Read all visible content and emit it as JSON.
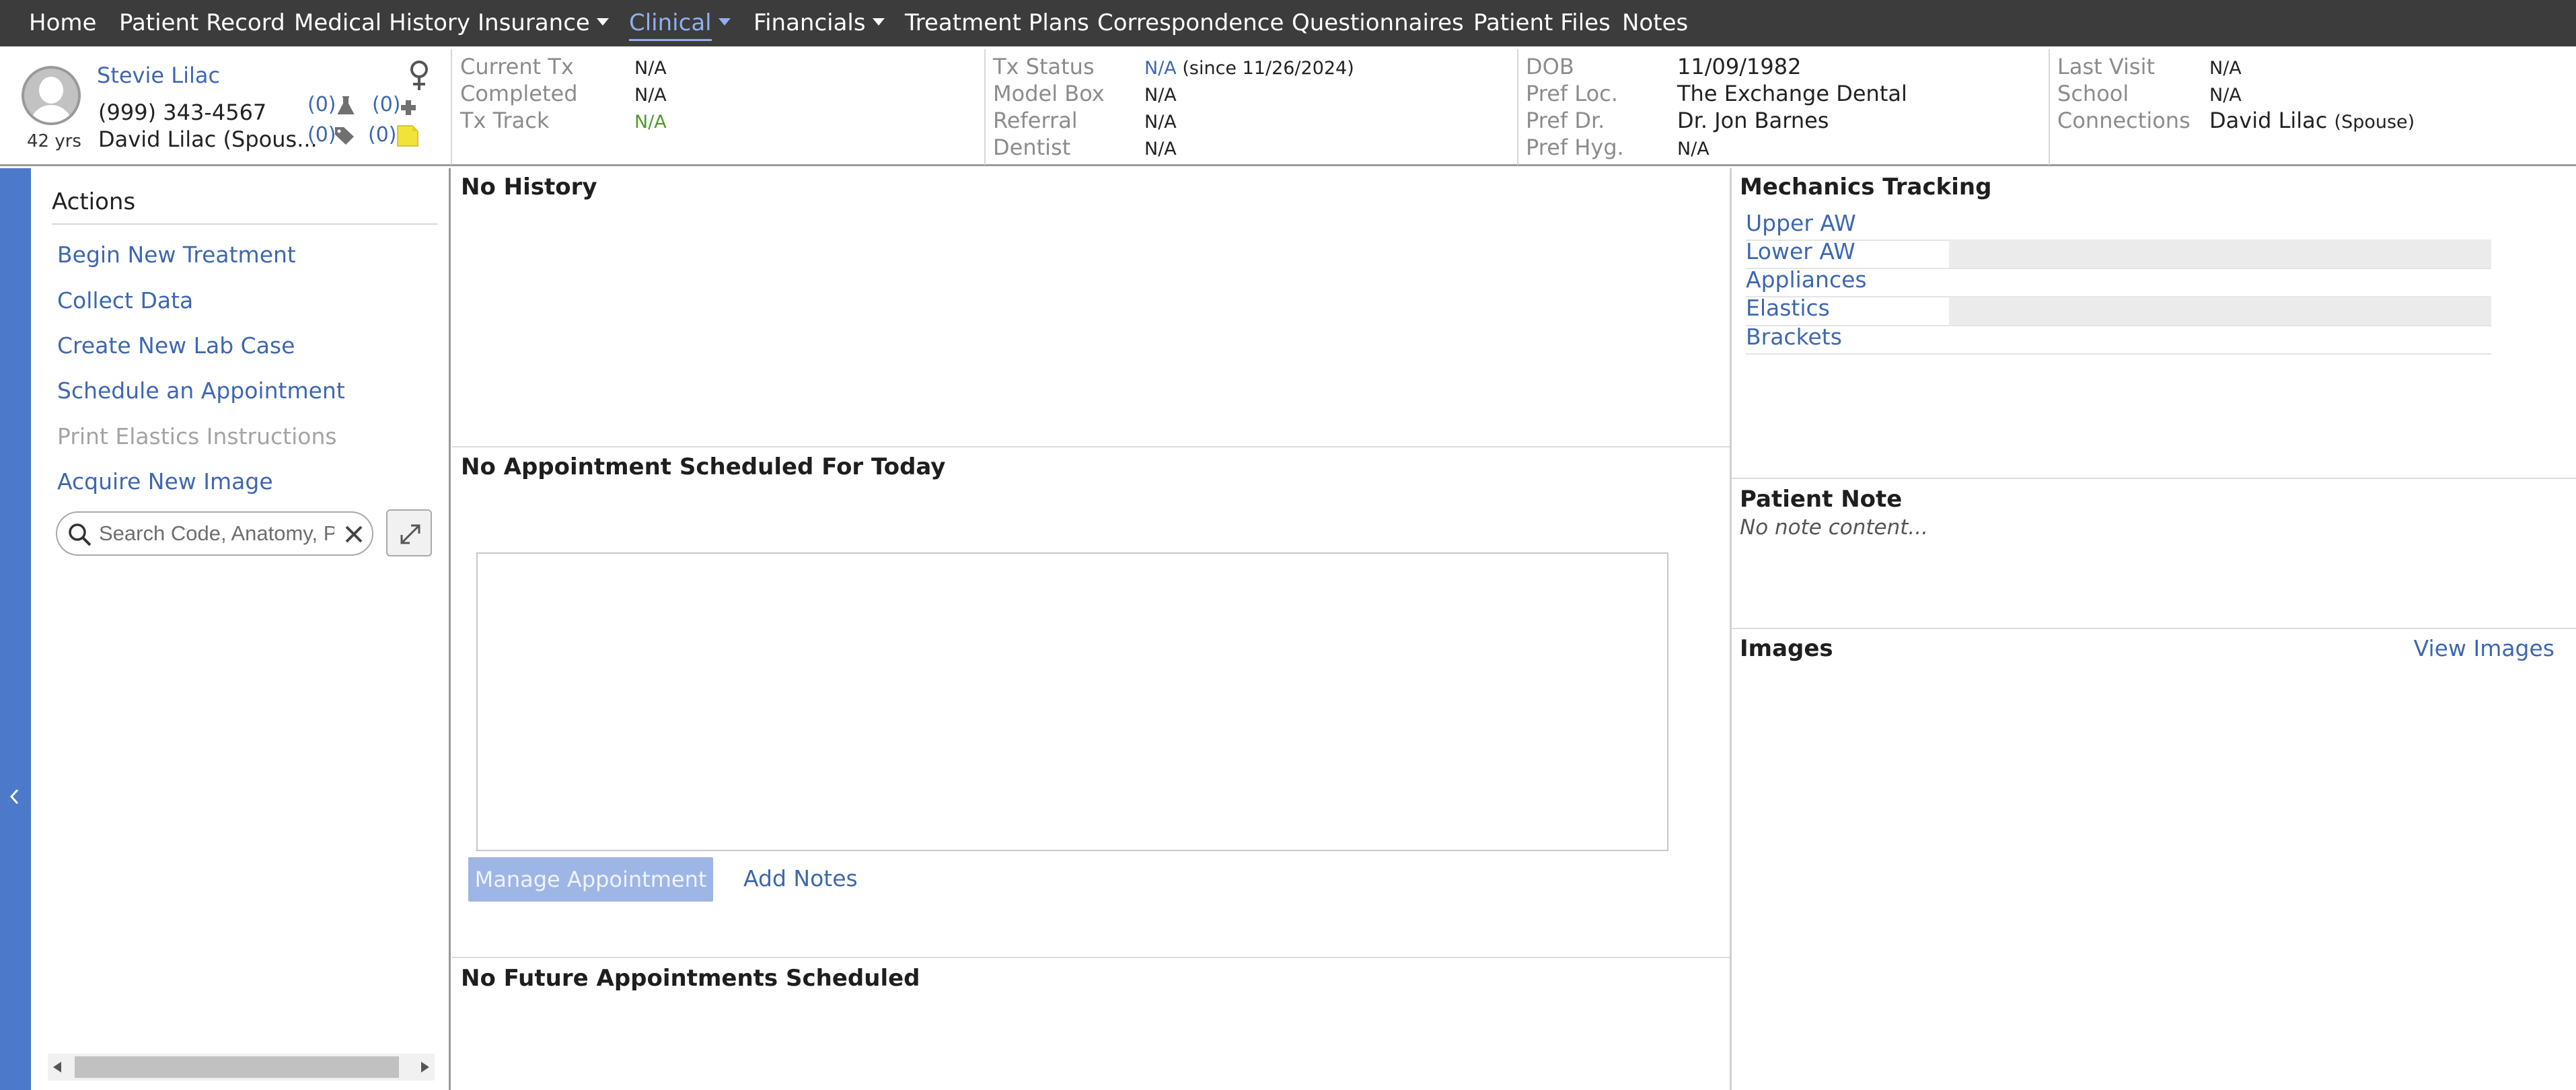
{
  "nav": {
    "items": [
      "Home",
      "Patient Record",
      "Medical History",
      "Insurance",
      "Clinical",
      "Financials",
      "Treatment Plans",
      "Correspondence",
      "Questionnaires",
      "Patient Files",
      "Notes"
    ],
    "active": "Clinical"
  },
  "patient": {
    "name": "Stevie Lilac",
    "age": "42 yrs",
    "phone": "(999) 343-4567",
    "connection_short": "David Lilac (Spous...",
    "counts": {
      "lab": "(0)",
      "medical": "(0)",
      "tags": "(0)",
      "notes": "(0)"
    }
  },
  "summary": {
    "col1": {
      "current_tx": {
        "label": "Current Tx",
        "value": "N/A"
      },
      "completed": {
        "label": "Completed",
        "value": "N/A"
      },
      "tx_track": {
        "label": "Tx Track",
        "value": "N/A"
      }
    },
    "col2": {
      "tx_status": {
        "label": "Tx Status",
        "value": "N/A",
        "since": "(since 11/26/2024)"
      },
      "model_box": {
        "label": "Model Box",
        "value": "N/A"
      },
      "referral": {
        "label": "Referral",
        "value": "N/A"
      },
      "dentist": {
        "label": "Dentist",
        "value": "N/A"
      }
    },
    "col3": {
      "dob": {
        "label": "DOB",
        "value": "11/09/1982"
      },
      "pref_loc": {
        "label": "Pref Loc.",
        "value": "The Exchange Dental"
      },
      "pref_dr": {
        "label": "Pref Dr.",
        "value": "Dr. Jon Barnes"
      },
      "pref_hyg": {
        "label": "Pref Hyg.",
        "value": "N/A"
      }
    },
    "col4": {
      "last_visit": {
        "label": "Last Visit",
        "value": "N/A"
      },
      "school": {
        "label": "School",
        "value": "N/A"
      },
      "connections": {
        "label": "Connections",
        "value": "David Lilac",
        "relation": "(Spouse)"
      }
    }
  },
  "actions": {
    "title": "Actions",
    "items": [
      "Begin New Treatment",
      "Collect Data",
      "Create New Lab Case",
      "Schedule an Appointment",
      "Print Elastics Instructions",
      "Acquire New Image"
    ],
    "disabled": [
      "Print Elastics Instructions"
    ],
    "search_placeholder": "Search Code, Anatomy, Proc..."
  },
  "center": {
    "history_title": "No History",
    "today_title": "No Appointment Scheduled For Today",
    "manage_button": "Manage Appointment",
    "add_notes": "Add Notes",
    "future_title": "No Future Appointments Scheduled"
  },
  "right": {
    "mechanics_title": "Mechanics Tracking",
    "mechanics_items": [
      "Upper AW",
      "Lower AW",
      "Appliances",
      "Elastics",
      "Brackets"
    ],
    "patient_note_title": "Patient Note",
    "patient_note_text": "No note content...",
    "images_title": "Images",
    "view_images": "View Images"
  },
  "colors": {
    "nav_bg": "#3c3c3c",
    "link": "#3e67b1",
    "accent_strip": "#4c79c9",
    "active_nav": "#8fb0ee",
    "tx_track_green": "#4e9a2a",
    "disabled_button": "#9db6e6"
  },
  "icons": [
    "user-avatar-icon",
    "female-gender-icon",
    "flask-icon",
    "medical-cross-icon",
    "tag-icon",
    "sticky-note-icon",
    "search-icon",
    "clear-icon",
    "expand-icon",
    "chevron-left-icon",
    "caret-down-icon"
  ]
}
